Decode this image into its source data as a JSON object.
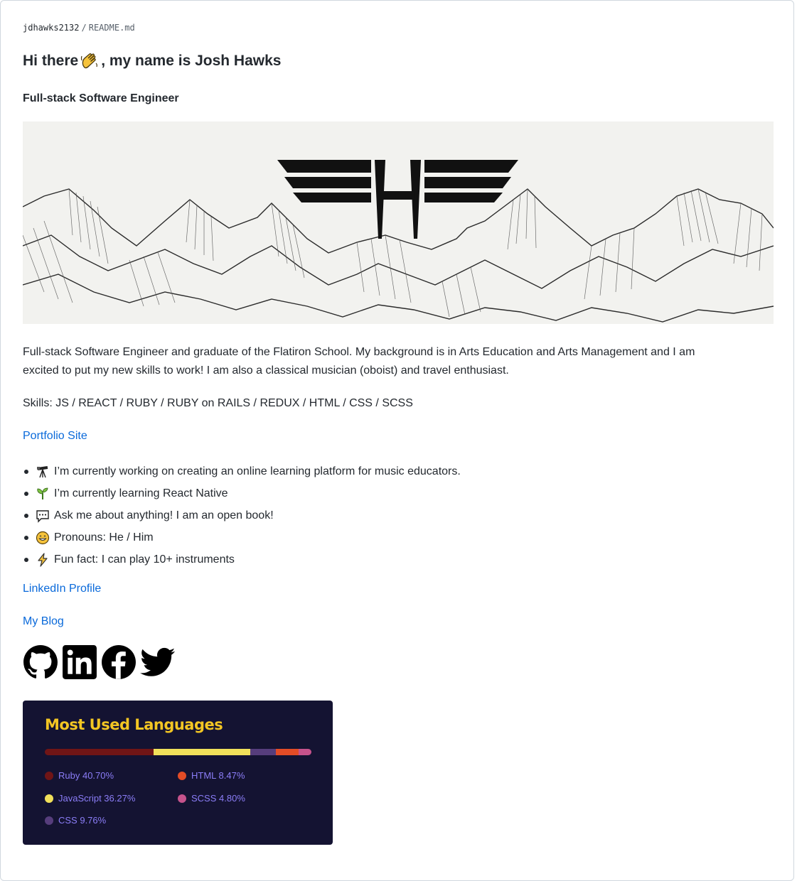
{
  "breadcrumb": {
    "user": "jdhawks2132",
    "sep": "/",
    "file": "README.md"
  },
  "heading": {
    "before": "Hi there",
    "after": ", my name is Josh Hawks"
  },
  "subheading": "Full-stack Software Engineer",
  "bio": {
    "line1": "Full-stack Software Engineer and graduate of the Flatiron School. My background is in Arts Education and Arts Management and I am",
    "line2": "excited to put my new skills to work! I am also a classical musician (oboist) and travel enthusiast."
  },
  "skills": "Skills: JS / REACT / RUBY / RUBY on RAILS / REDUX / HTML / CSS / SCSS",
  "links": {
    "portfolio": "Portfolio Site",
    "linkedin": "LinkedIn Profile",
    "blog": "My Blog"
  },
  "bullets": [
    {
      "icon": "telescope-icon",
      "text": "I’m currently working on creating an online learning platform for music educators."
    },
    {
      "icon": "seedling-icon",
      "text": "I’m currently learning React Native"
    },
    {
      "icon": "speech-balloon-icon",
      "text": "Ask me about anything! I am an open book!"
    },
    {
      "icon": "smile-icon",
      "text": "Pronouns: He / Him"
    },
    {
      "icon": "lightning-icon",
      "text": "Fun fact: I can play 10+ instruments"
    }
  ],
  "socials": [
    "github-icon",
    "linkedin-icon",
    "facebook-icon",
    "twitter-icon"
  ],
  "languages": {
    "title": "Most Used Languages",
    "items": [
      {
        "name": "Ruby",
        "pct": 40.7,
        "label": "Ruby 40.70%",
        "color": "#701516"
      },
      {
        "name": "JavaScript",
        "pct": 36.27,
        "label": "JavaScript 36.27%",
        "color": "#f1e05a"
      },
      {
        "name": "CSS",
        "pct": 9.76,
        "label": "CSS 9.76%",
        "color": "#563d7c"
      },
      {
        "name": "HTML",
        "pct": 8.47,
        "label": "HTML 8.47%",
        "color": "#e34c26"
      },
      {
        "name": "SCSS",
        "pct": 4.8,
        "label": "SCSS 4.80%",
        "color": "#c6538c"
      }
    ]
  },
  "colors": {
    "link": "#0969da",
    "card_bg": "#141332",
    "card_title": "#f3c623",
    "card_text": "#8b7df7"
  }
}
